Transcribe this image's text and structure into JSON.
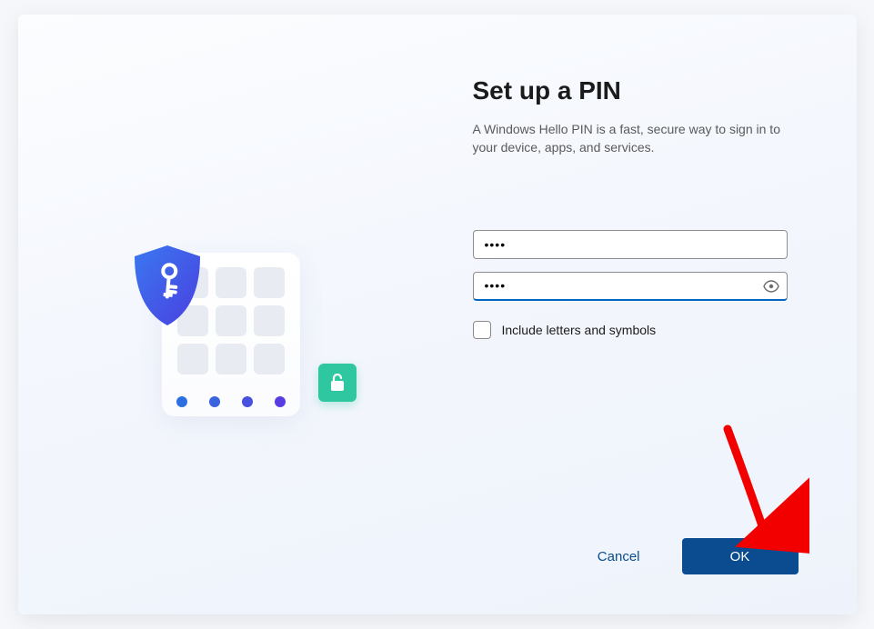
{
  "title": "Set up a PIN",
  "description": "A Windows Hello PIN is a fast, secure way to sign in to your device, apps, and services.",
  "fields": {
    "pin": {
      "value": "••••"
    },
    "confirm_pin": {
      "value": "••••"
    }
  },
  "checkbox": {
    "include_letters_label": "Include letters and symbols",
    "checked": false
  },
  "buttons": {
    "cancel": "Cancel",
    "ok": "OK"
  },
  "colors": {
    "primary": "#0a4c8f",
    "accent_teal": "#2ec7a0",
    "shield_start": "#3a78f0",
    "shield_end": "#4a3fe0",
    "arrow": "#f20000"
  }
}
